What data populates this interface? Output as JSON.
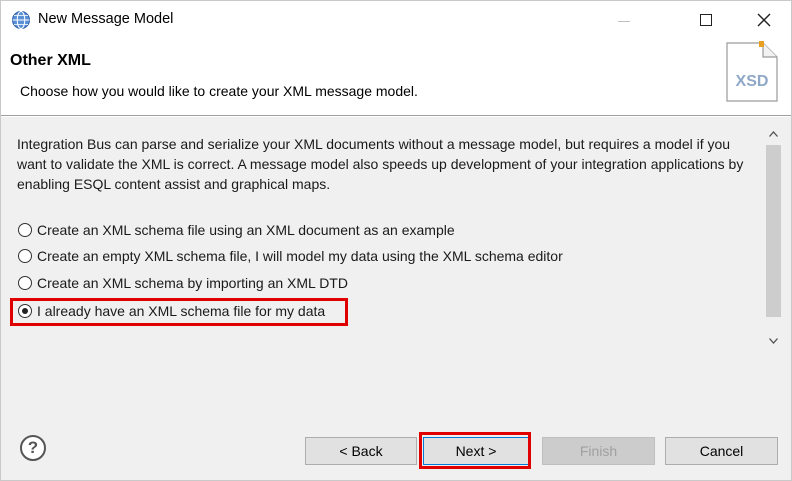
{
  "window": {
    "title": "New Message Model",
    "controls": {
      "minimize": "minimize",
      "maximize": "maximize",
      "close": "✕"
    }
  },
  "header": {
    "title": "Other XML",
    "description": "Choose how you would like to create your XML message model.",
    "icon_label": "XSD"
  },
  "content": {
    "intro": "Integration Bus can parse and serialize your XML documents without a message model, but requires a model if you want to validate the XML is correct. A message model also speeds up development of your integration applications by enabling ESQL content assist and graphical maps.",
    "options": [
      {
        "label": "Create an XML schema file using an XML document as an example",
        "selected": false
      },
      {
        "label": "Create an empty XML schema file, I will model my data using the XML schema editor",
        "selected": false
      },
      {
        "label": "Create an XML schema by importing an XML DTD",
        "selected": false
      },
      {
        "label": "I already have an XML schema file for my data",
        "selected": true
      }
    ]
  },
  "footer": {
    "help": "?",
    "back_label": "< Back",
    "next_label": "Next >",
    "finish_label": "Finish",
    "cancel_label": "Cancel"
  },
  "colors": {
    "highlight": "#e00000",
    "background": "#f0f0f0",
    "button": "#e1e1e1"
  }
}
